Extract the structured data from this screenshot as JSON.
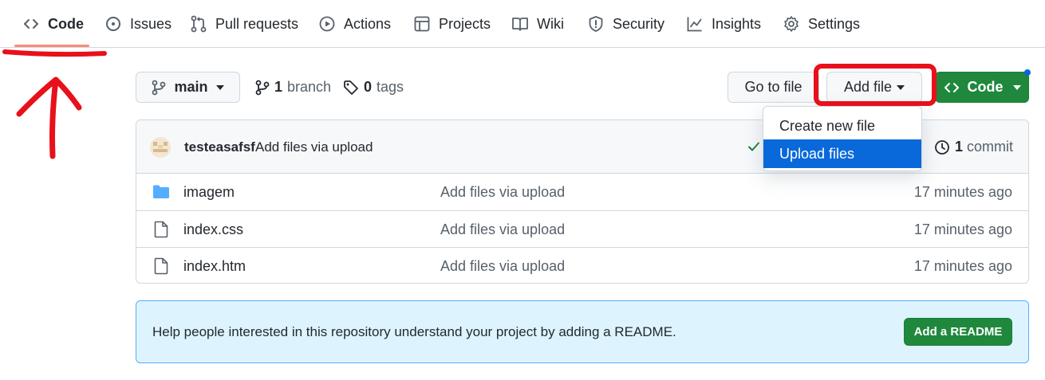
{
  "nav": {
    "tabs": [
      {
        "label": "Code",
        "icon": "code-icon",
        "selected": true
      },
      {
        "label": "Issues",
        "icon": "issue-icon"
      },
      {
        "label": "Pull requests",
        "icon": "pull-request-icon"
      },
      {
        "label": "Actions",
        "icon": "play-icon"
      },
      {
        "label": "Projects",
        "icon": "table-icon"
      },
      {
        "label": "Wiki",
        "icon": "book-icon"
      },
      {
        "label": "Security",
        "icon": "shield-icon"
      },
      {
        "label": "Insights",
        "icon": "graph-icon"
      },
      {
        "label": "Settings",
        "icon": "gear-icon"
      }
    ]
  },
  "toolbar": {
    "branch_name": "main",
    "branch_count": "1",
    "branch_label": "branch",
    "tag_count": "0",
    "tag_label": "tags",
    "go_to_file": "Go to file",
    "add_file": "Add file",
    "code": "Code"
  },
  "dropdown": {
    "items": [
      {
        "label": "Create new file",
        "active": false
      },
      {
        "label": "Upload files",
        "active": true
      }
    ]
  },
  "commit": {
    "author": "testeasafsf",
    "message": "Add files via upload",
    "count": "1",
    "count_label": "commit"
  },
  "files": [
    {
      "name": "imagem",
      "type": "folder",
      "message": "Add files via upload",
      "age": "17 minutes ago"
    },
    {
      "name": "index.css",
      "type": "file",
      "message": "Add files via upload",
      "age": "17 minutes ago"
    },
    {
      "name": "index.htm",
      "type": "file",
      "message": "Add files via upload",
      "age": "17 minutes ago"
    }
  ],
  "readme_banner": {
    "text": "Help people interested in this repository understand your project by adding a README.",
    "button": "Add a README"
  },
  "colors": {
    "accent_blue": "#0969da",
    "green": "#1f883d",
    "annotation_red": "#e8101a",
    "tab_underline": "#fd8c73",
    "folder_blue": "#54aeff"
  }
}
